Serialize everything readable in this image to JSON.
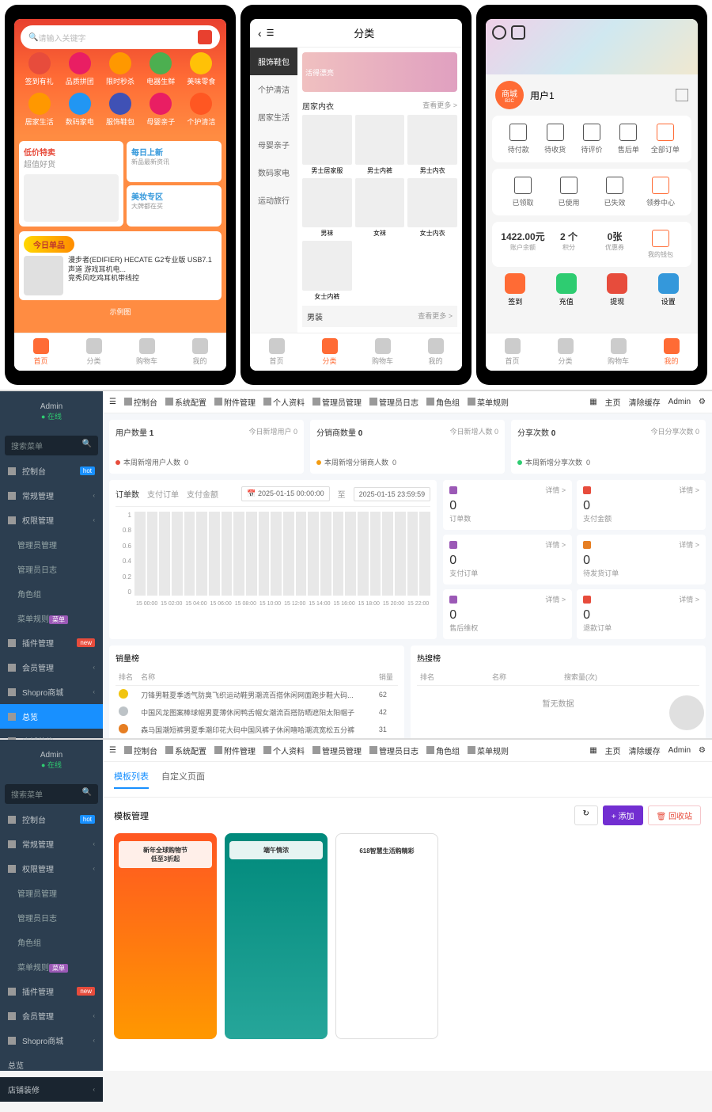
{
  "phone1": {
    "search_placeholder": "请输入关键字",
    "cats_r1": [
      {
        "label": "签到有礼",
        "color": "#e74c3c"
      },
      {
        "label": "品质拼团",
        "color": "#e91e63"
      },
      {
        "label": "限时秒杀",
        "color": "#ff9800"
      },
      {
        "label": "电器生鲜",
        "color": "#4caf50"
      },
      {
        "label": "美味零食",
        "color": "#ffc107"
      }
    ],
    "cats_r2": [
      {
        "label": "居家生活",
        "color": "#ff9800"
      },
      {
        "label": "数码家电",
        "color": "#2196f3"
      },
      {
        "label": "服饰鞋包",
        "color": "#3f51b5"
      },
      {
        "label": "母婴亲子",
        "color": "#e91e63"
      },
      {
        "label": "个护清洁",
        "color": "#ff5722"
      }
    ],
    "left_card": {
      "title": "低价特卖",
      "sub": "超值好货"
    },
    "right_cards": [
      {
        "title": "每日上新",
        "sub": "新品最新资讯"
      },
      {
        "title": "美妆专区",
        "sub": "大牌都在买"
      }
    ],
    "today_label": "今日单品",
    "product_title": "漫步者(EDIFIER) HECATE G2专业版 USB7.1声道 游戏耳机电...",
    "product_sub": "竞秀风吃鸡耳机带线控",
    "footer_tag": "示例图",
    "tabs": [
      "首页",
      "分类",
      "购物车",
      "我的"
    ]
  },
  "phone2": {
    "title": "分类",
    "side": [
      "服饰鞋包",
      "个护清洁",
      "居家生活",
      "母婴亲子",
      "数码家电",
      "运动旅行"
    ],
    "banner": "活得漂亮",
    "sec1": "居家内衣",
    "more": "查看更多 >",
    "items1": [
      "男士居家服",
      "男士内裤",
      "男士内衣",
      "男袜",
      "女袜",
      "女士内衣",
      "女士内裤"
    ],
    "sec2": "男装",
    "tabs": [
      "首页",
      "分类",
      "购物车",
      "我的"
    ]
  },
  "phone3": {
    "avatar_label": "商城",
    "avatar_sub": "B2C",
    "username": "用户1",
    "orders": [
      "待付款",
      "待收货",
      "待评价",
      "售后单",
      "全部订单"
    ],
    "coupons": [
      "已领取",
      "已使用",
      "已失效",
      "领券中心"
    ],
    "wallet": [
      {
        "num": "1422.00元",
        "lbl": "账户余额"
      },
      {
        "num": "2 个",
        "lbl": "积分"
      },
      {
        "num": "0张",
        "lbl": "优惠券"
      },
      {
        "num": "",
        "lbl": "我的钱包"
      }
    ],
    "actions": [
      {
        "label": "签到",
        "color": "#ff6b35"
      },
      {
        "label": "充值",
        "color": "#2ecc71"
      },
      {
        "label": "提现",
        "color": "#e74c3c"
      },
      {
        "label": "设置",
        "color": "#3498db"
      }
    ],
    "tabs": [
      "首页",
      "分类",
      "购物车",
      "我的"
    ]
  },
  "admin": {
    "user": "Admin",
    "status": "● 在线",
    "search_placeholder": "搜索菜单",
    "menu": [
      {
        "label": "控制台",
        "icon": "dashboard-icon",
        "badge": "hot",
        "bclass": "b-hot"
      },
      {
        "label": "常规管理",
        "icon": "settings-icon",
        "chev": true
      },
      {
        "label": "权限管理",
        "icon": "lock-icon",
        "chev": true
      }
    ],
    "submenu": [
      "管理员管理",
      "管理员日志",
      "角色组",
      "菜单规则"
    ],
    "submenu_badge": "菜单",
    "menu2": [
      {
        "label": "插件管理",
        "icon": "plugin-icon",
        "badge": "new",
        "bclass": "b-new"
      },
      {
        "label": "会员管理",
        "icon": "member-icon",
        "chev": true
      },
      {
        "label": "Shopro商城",
        "icon": "shop-icon",
        "chev": true
      }
    ],
    "menu3": [
      {
        "label": "总览",
        "act": true
      },
      {
        "label": "店铺装修",
        "chev": true
      }
    ],
    "topbar": [
      "控制台",
      "系统配置",
      "附件管理",
      "个人资料",
      "管理员管理",
      "管理员日志",
      "角色组",
      "菜单规则"
    ],
    "topbar_r": [
      "主页",
      "清除缓存",
      "Admin"
    ],
    "stats": [
      {
        "title": "用户数量",
        "val": "1",
        "sub": "今日新增用户",
        "subval": "0",
        "wk": "本周新增用户人数",
        "wkval": "0",
        "color": "#e74c3c"
      },
      {
        "title": "分销商数量",
        "val": "0",
        "sub": "今日新增人数",
        "subval": "0",
        "wk": "本周新增分销商人数",
        "wkval": "0",
        "color": "#f39c12"
      },
      {
        "title": "分享次数",
        "val": "0",
        "sub": "今日分享次数",
        "subval": "0",
        "wk": "本周新增分享次数",
        "wkval": "0",
        "color": "#2ecc71"
      }
    ],
    "chart_tabs": [
      "订单数",
      "支付订单",
      "支付金额"
    ],
    "date_from": "2025-01-15 00:00:00",
    "date_to_label": "至",
    "date_to": "2025-01-15 23:59:59",
    "minis": [
      {
        "lbl": "订单数",
        "color": "#9b59b6"
      },
      {
        "lbl": "支付金额",
        "color": "#e74c3c"
      },
      {
        "lbl": "支付订单",
        "color": "#9b59b6"
      },
      {
        "lbl": "待发货订单",
        "color": "#e67e22"
      },
      {
        "lbl": "售后维权",
        "color": "#9b59b6"
      },
      {
        "lbl": "退款订单",
        "color": "#e74c3c"
      }
    ],
    "mini_more": "详情 >",
    "mini_val": "0",
    "rank_title": "销量榜",
    "rank_cols": [
      "排名",
      "名称",
      "销量"
    ],
    "ranks": [
      {
        "medal": "#f1c40f",
        "name": "刀锋男鞋夏季透气防臭飞织运动鞋男潮流百搭休闲网面跑步鞋大码...",
        "val": "62"
      },
      {
        "medal": "#bdc3c7",
        "name": "中国风龙图案棒球帽男夏薄休闲鸭舌帽女潮流百搭防晒遮阳太阳帽子",
        "val": "42"
      },
      {
        "medal": "#e67e22",
        "name": "森马国潮短裤男夏季潮印花大码中国风裤子休闲嘻哈潮流宽松五分裤",
        "val": "31"
      }
    ],
    "hot_title": "热搜榜",
    "hot_cols": [
      "排名",
      "名称",
      "搜索量(次)"
    ],
    "hot_empty": "暂无数据"
  },
  "chart_data": {
    "type": "bar",
    "title": "订单数",
    "y_ticks": [
      "1",
      "0.8",
      "0.6",
      "0.4",
      "0.2",
      "0"
    ],
    "x_ticks": [
      "15 00:00",
      "15 02:00",
      "15 04:00",
      "15 06:00",
      "15 08:00",
      "15 10:00",
      "15 12:00",
      "15 14:00",
      "15 16:00",
      "15 18:00",
      "15 20:00",
      "15 22:00"
    ],
    "values": [
      0,
      0,
      0,
      0,
      0,
      0,
      0,
      0,
      0,
      0,
      0,
      0,
      0,
      0,
      0,
      0,
      0,
      0,
      0,
      0,
      0,
      0,
      0,
      0
    ],
    "ylim": [
      0,
      1
    ]
  },
  "admin2": {
    "tabs": [
      "模板列表",
      "自定义页面"
    ],
    "title": "模板管理",
    "btn_refresh": "↻",
    "btn_add": "+ 添加",
    "btn_recycle": "🗑 回收站",
    "templates": [
      {
        "title": "新年全球购物节",
        "sub": "低至3折起"
      },
      {
        "title": "端午情浓",
        "sub": ""
      },
      {
        "title": "618智慧生活购精彩",
        "sub": ""
      }
    ]
  }
}
